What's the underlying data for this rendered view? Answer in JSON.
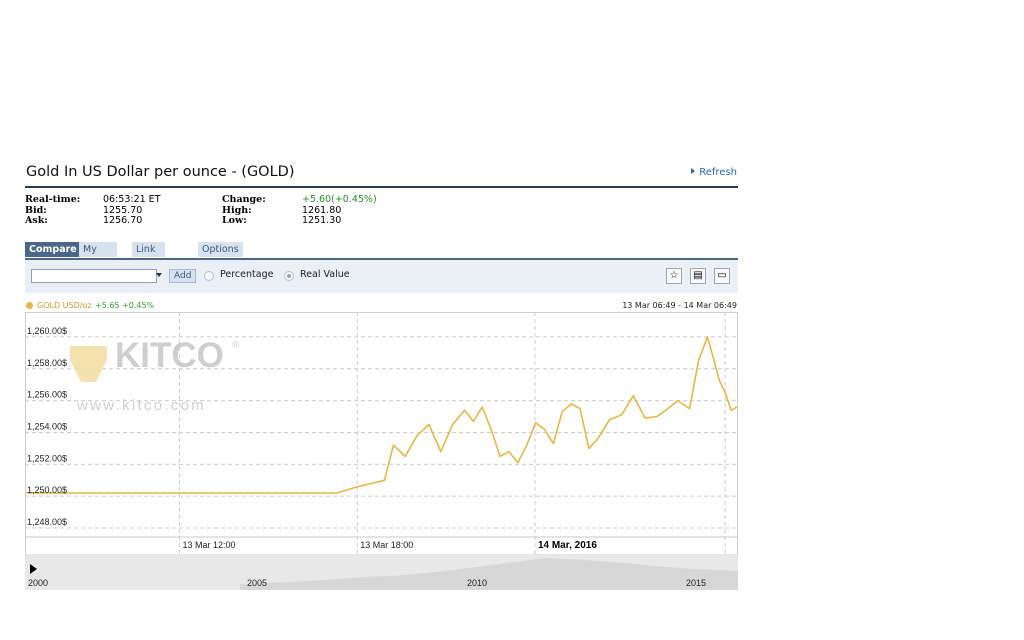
{
  "header": {
    "title": "Gold In US Dollar per ounce - (GOLD)",
    "refresh_label": "Refresh"
  },
  "quote": {
    "realtime_label": "Real-time:",
    "realtime_value": "06:53:21 ET",
    "bid_label": "Bid:",
    "bid_value": "1255.70",
    "ask_label": "Ask:",
    "ask_value": "1256.70",
    "change_label": "Change:",
    "change_value": "+5.60(+0.45%)",
    "high_label": "High:",
    "high_value": "1261.80",
    "low_label": "Low:",
    "low_value": "1251.30"
  },
  "tabs": [
    {
      "label": "Compare"
    },
    {
      "label": "My charts"
    },
    {
      "label": "Link to chart"
    },
    {
      "label": "Options"
    }
  ],
  "toolbar": {
    "input_value": "",
    "add_label": "Add",
    "percentage_label": "Percentage",
    "real_value_label": "Real Value",
    "selected_mode": "Real Value"
  },
  "legend": {
    "series_label": "GOLD USD/oz",
    "change": "+5.65  +0.45%",
    "range": "13 Mar 06:49 - 14 Mar 06:49"
  },
  "watermark": {
    "brand": "KITCO",
    "url": "www.kitco.com"
  },
  "colors": {
    "accent": "#e5b844",
    "header_bar": "#2b3a4d",
    "tab_active": "#4a6787",
    "up": "#2e8b2e"
  },
  "chart_data": {
    "type": "line",
    "y_axis": {
      "min": 1247.5,
      "max": 1261.5,
      "ticks": [
        "1,260.00$",
        "1,258.00$",
        "1,256.00$",
        "1,254.00$",
        "1,252.00$",
        "1,250.00$",
        "1,248.00$"
      ],
      "tick_values": [
        1260,
        1258,
        1256,
        1254,
        1252,
        1250,
        1248
      ]
    },
    "x_axis": {
      "labels": [
        "13 Mar 12:00",
        "13 Mar 18:00",
        "14 Mar, 2016"
      ],
      "label_hours": [
        5.18,
        11.18,
        17.18
      ],
      "bold_label_index": 2,
      "range_hours": [
        0,
        24
      ]
    },
    "series": [
      {
        "color": "#e5b844",
        "x": [
          0,
          3,
          6,
          8,
          10.5,
          11.2,
          12.1,
          12.4,
          12.8,
          13.2,
          13.6,
          14.0,
          14.4,
          14.8,
          15.1,
          15.4,
          15.7,
          16.0,
          16.3,
          16.6,
          16.9,
          17.2,
          17.5,
          17.8,
          18.1,
          18.4,
          18.7,
          19.0,
          19.3,
          19.7,
          20.1,
          20.5,
          20.9,
          21.3,
          21.6,
          22.0,
          22.4,
          22.7,
          23.0,
          23.2,
          23.4,
          23.6,
          23.8,
          24.0
        ],
        "y": [
          1250.2,
          1250.2,
          1250.2,
          1250.2,
          1250.2,
          1250.6,
          1251.0,
          1253.2,
          1252.5,
          1253.8,
          1254.5,
          1252.8,
          1254.5,
          1255.4,
          1254.7,
          1255.6,
          1254.2,
          1252.5,
          1252.8,
          1252.1,
          1253.2,
          1254.6,
          1254.2,
          1253.3,
          1255.3,
          1255.8,
          1255.5,
          1253.0,
          1253.6,
          1254.8,
          1255.1,
          1256.3,
          1254.9,
          1255.0,
          1255.4,
          1256.0,
          1255.5,
          1258.5,
          1260.0,
          1258.7,
          1257.3,
          1256.5,
          1255.4,
          1255.6
        ]
      }
    ],
    "navigator": {
      "labels": [
        "2000",
        "2005",
        "2010",
        "2015"
      ]
    }
  }
}
